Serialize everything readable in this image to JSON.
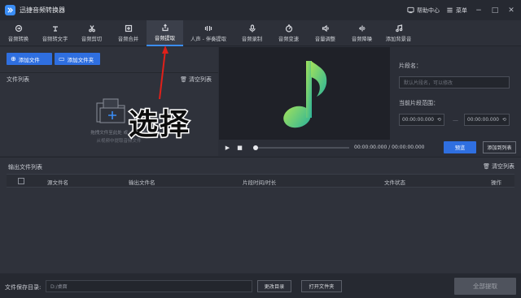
{
  "app": {
    "title": "迅捷音频转换器",
    "help_label": "帮助中心",
    "menu_label": "菜单"
  },
  "toolbar": {
    "items": [
      {
        "label": "音频转换",
        "icon": "convert-icon"
      },
      {
        "label": "音频转文字",
        "icon": "speech-to-text-icon"
      },
      {
        "label": "音频剪切",
        "icon": "scissors-icon"
      },
      {
        "label": "音频合并",
        "icon": "merge-icon"
      },
      {
        "label": "音频提取",
        "icon": "extract-icon",
        "active": true
      },
      {
        "label": "人声 - 伴奏提取",
        "icon": "vocal-icon"
      },
      {
        "label": "音频录制",
        "icon": "microphone-icon"
      },
      {
        "label": "音频变速",
        "icon": "speed-icon"
      },
      {
        "label": "音量调整",
        "icon": "volume-icon"
      },
      {
        "label": "音频降噪",
        "icon": "denoise-icon"
      },
      {
        "label": "添加背景音",
        "icon": "background-music-icon"
      }
    ]
  },
  "file_list": {
    "add_file": "添加文件",
    "add_folder": "添加文件夹",
    "title": "文件列表",
    "clear": "清空列表",
    "drop_hint1": "拖拽文件至此处 或 点击添加",
    "drop_hint2": "从视频中提取音频文件"
  },
  "overlay_text": "选择",
  "player": {
    "time": "00:00:00.000 / 00:00:00.000",
    "preview": "预览",
    "add_to_list": "添加到列表"
  },
  "segment": {
    "name_label": "片段名：",
    "name_placeholder": "默认片段名，可以修改",
    "range_label": "当前片段范围：",
    "start": "00:00:00.000",
    "end": "00:00:00.000"
  },
  "output": {
    "title": "输出文件列表",
    "clear": "清空列表",
    "columns": [
      "源文件名",
      "输出文件名",
      "片段时间/时长",
      "文件状态",
      "操作"
    ]
  },
  "footer": {
    "label": "文件保存目录:",
    "path": "D:/桌面",
    "change_dir": "更改目录",
    "open_folder": "打开文件夹",
    "extract_all": "全部提取"
  },
  "colors": {
    "accent": "#2f6fe0",
    "background": "#2b2e37",
    "note_green": "#7fd65a"
  }
}
